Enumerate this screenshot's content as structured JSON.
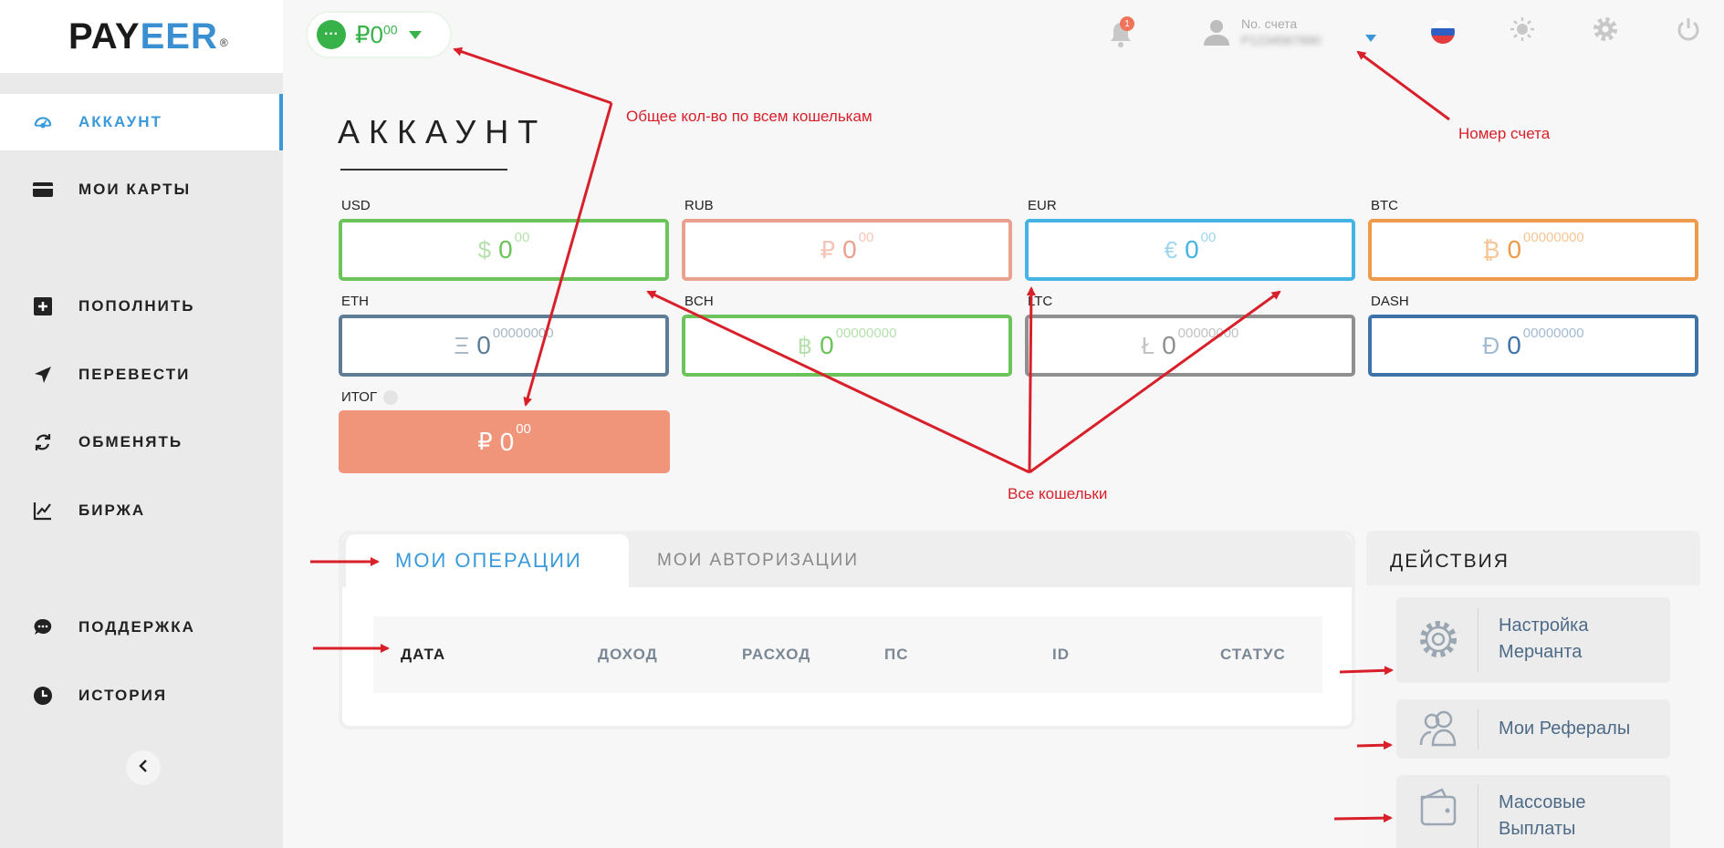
{
  "logo": {
    "part1": "PAY",
    "part2": "EER",
    "mark": "®"
  },
  "sidebar": {
    "items": [
      {
        "label": "АККАУНТ",
        "icon": "dashboard-icon",
        "active": true
      },
      {
        "label": "МОИ КАРТЫ",
        "icon": "credit-card-icon"
      },
      {
        "label": "ПОПОЛНИТЬ",
        "icon": "plus-square-icon"
      },
      {
        "label": "ПЕРЕВЕСТИ",
        "icon": "send-icon"
      },
      {
        "label": "ОБМЕНЯТЬ",
        "icon": "exchange-icon"
      },
      {
        "label": "БИРЖА",
        "icon": "chart-icon"
      },
      {
        "label": "ПОДДЕРЖКА",
        "icon": "chat-icon"
      },
      {
        "label": "ИСТОРИЯ",
        "icon": "clock-icon"
      }
    ]
  },
  "header": {
    "balance": {
      "symbol": "₽",
      "value": "0",
      "decimals": "00",
      "dot": "···"
    },
    "notifications": {
      "count": "1"
    },
    "account": {
      "label": "No. счета",
      "number": "P1234567890"
    },
    "language": "ru",
    "accent": "#3a9ad9"
  },
  "main": {
    "title": "АККАУНТ",
    "wallets": [
      {
        "code": "USD",
        "symbol": "$",
        "value": "0",
        "decimals": "00",
        "color": "#6cc35a",
        "textColor": "#6cc35a",
        "symColor": "#b6e0ae"
      },
      {
        "code": "RUB",
        "symbol": "₽",
        "value": "0",
        "decimals": "00",
        "color": "#e9a08e",
        "textColor": "#e9a08e",
        "symColor": "#f2c5b9"
      },
      {
        "code": "EUR",
        "symbol": "€",
        "value": "0",
        "decimals": "00",
        "color": "#45b4e5",
        "textColor": "#45b4e5",
        "symColor": "#9ed6ef"
      },
      {
        "code": "BTC",
        "symbol": "₿",
        "value": "0",
        "decimals": "00000000",
        "color": "#ee9a4b",
        "textColor": "#ee9a4b",
        "symColor": "#f5c594"
      },
      {
        "code": "ETH",
        "symbol": "Ξ",
        "value": "0",
        "decimals": "00000000",
        "color": "#5d7d97",
        "textColor": "#5d7d97",
        "symColor": "#a8b8c6"
      },
      {
        "code": "BCH",
        "symbol": "฿",
        "value": "0",
        "decimals": "00000000",
        "color": "#6cc35a",
        "textColor": "#6cc35a",
        "symColor": "#b6e0ae"
      },
      {
        "code": "LTC",
        "symbol": "Ł",
        "value": "0",
        "decimals": "00000000",
        "color": "#8f8f8f",
        "textColor": "#8f8f8f",
        "symColor": "#c2c2c2"
      },
      {
        "code": "DASH",
        "symbol": "Đ",
        "value": "0",
        "decimals": "00000000",
        "color": "#3e73a8",
        "textColor": "#3e73a8",
        "symColor": "#a2bad4"
      }
    ],
    "total": {
      "label": "ИТОГ",
      "symbol": "₽",
      "value": "0",
      "decimals": "00"
    }
  },
  "operations": {
    "tabs": [
      "МОИ ОПЕРАЦИИ",
      "МОИ АВТОРИЗАЦИИ"
    ],
    "columns": [
      "ДАТА",
      "ДОХОД",
      "РАСХОД",
      "ПС",
      "ID",
      "СТАТУС"
    ]
  },
  "actions": {
    "title": "ДЕЙСТВИЯ",
    "items": [
      {
        "line1": "Настройка",
        "line2": "Мерчанта",
        "icon": "gear-icon"
      },
      {
        "line1": "Мои Рефералы",
        "line2": "",
        "icon": "users-icon"
      },
      {
        "line1": "Массовые",
        "line2": "Выплаты",
        "icon": "wallet-icon"
      }
    ]
  },
  "annotations": {
    "total_note": "Общее кол-во по всем кошелькам",
    "account_note": "Номер счета",
    "wallets_note": "Все кошельки"
  }
}
